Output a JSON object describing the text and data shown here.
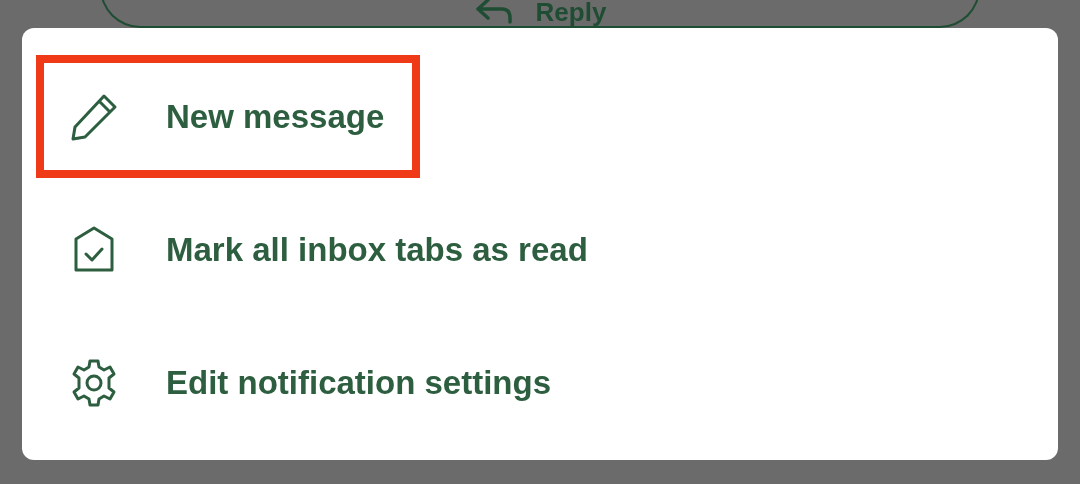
{
  "background": {
    "reply_button": {
      "label": "Reply"
    }
  },
  "menu": {
    "items": [
      {
        "kind": "compose",
        "label": "New message",
        "highlighted": true
      },
      {
        "kind": "mark-read",
        "label": "Mark all inbox tabs as read",
        "highlighted": false
      },
      {
        "kind": "settings",
        "label": "Edit notification settings",
        "highlighted": false
      }
    ]
  }
}
